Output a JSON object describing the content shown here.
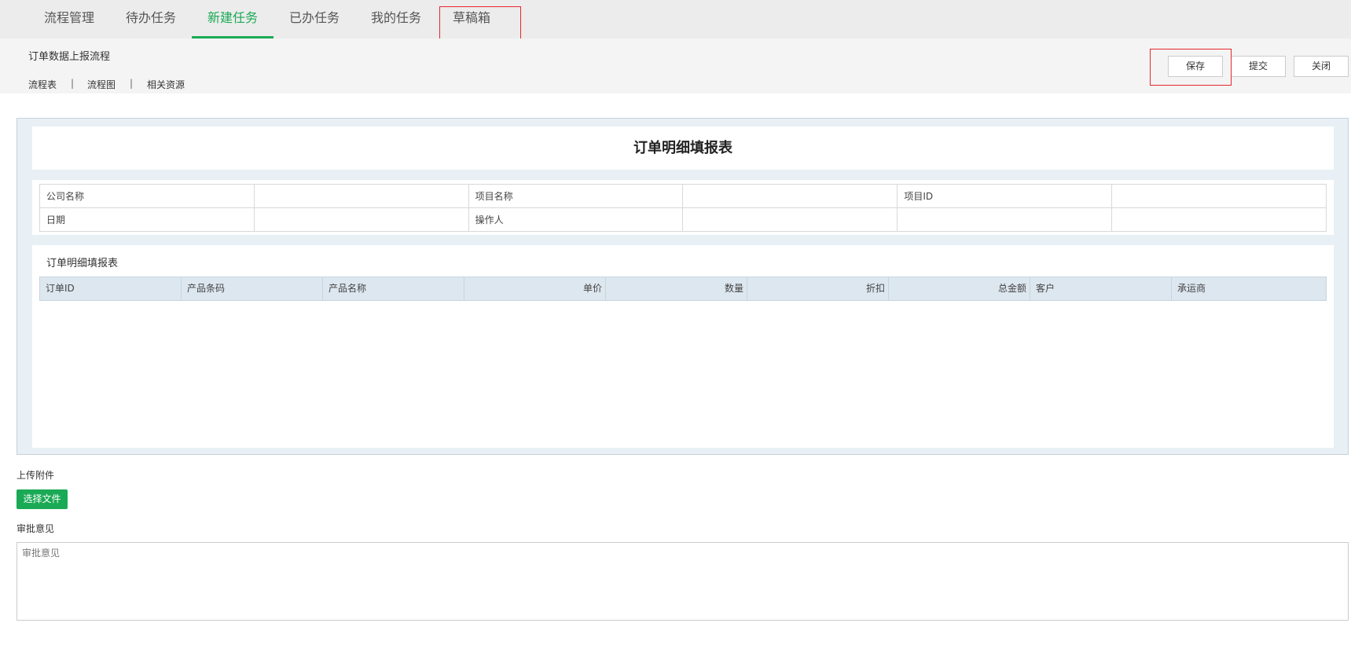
{
  "nav": {
    "tabs": [
      {
        "label": "流程管理"
      },
      {
        "label": "待办任务"
      },
      {
        "label": "新建任务"
      },
      {
        "label": "已办任务"
      },
      {
        "label": "我的任务"
      },
      {
        "label": "草稿箱"
      }
    ],
    "active_tab": "新建任务"
  },
  "subheader": {
    "flow_title": "订单数据上报流程",
    "links": [
      "流程表",
      "流程图",
      "相关资源"
    ],
    "separator": "|",
    "buttons": {
      "save": "保存",
      "submit": "提交",
      "close": "关闭"
    }
  },
  "form": {
    "title": "订单明细填报表",
    "info_rows": [
      [
        "公司名称",
        "",
        "项目名称",
        "",
        "项目ID",
        ""
      ],
      [
        "日期",
        "",
        "操作人",
        "",
        "",
        ""
      ]
    ],
    "detail": {
      "label": "订单明细填报表",
      "columns": [
        "订单ID",
        "产品条码",
        "产品名称",
        "单价",
        "数量",
        "折扣",
        "总金额",
        "客户",
        "承运商"
      ]
    }
  },
  "attachments": {
    "label": "上传附件",
    "button": "选择文件"
  },
  "approval": {
    "label": "审批意见",
    "placeholder": "审批意见"
  },
  "colors": {
    "accent": "#1aaa55",
    "highlight": "#e8262c",
    "header_bg": "#dde7f0"
  }
}
